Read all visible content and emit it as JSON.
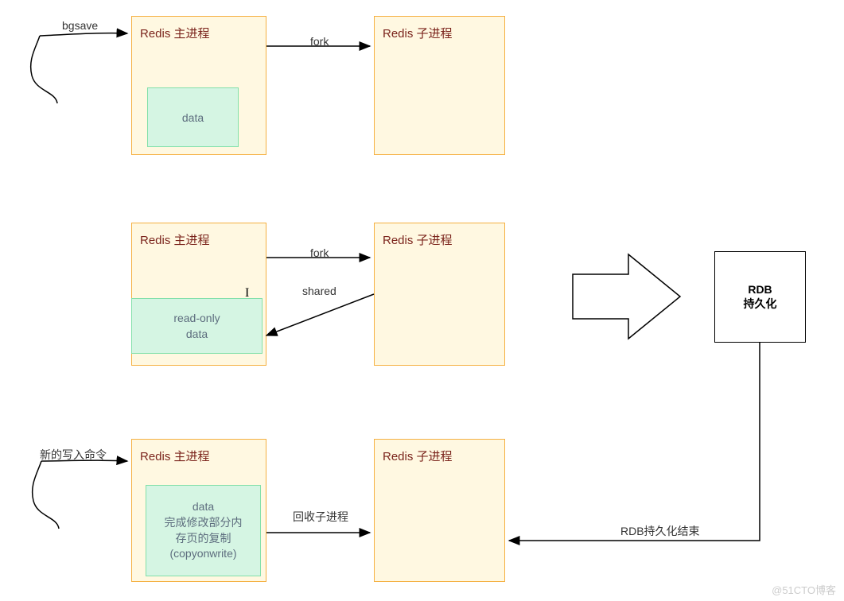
{
  "row1": {
    "mainTitle": "Redis 主进程",
    "childTitle": "Redis 子进程",
    "dataLabel": "data",
    "arrowLabel": "fork",
    "inputLabel": "bgsave"
  },
  "row2": {
    "mainTitle": "Redis 主进程",
    "childTitle": "Redis 子进程",
    "dataLabel1": "read-only",
    "dataLabel2": "data",
    "arrowLabel1": "fork",
    "arrowLabel2": "shared"
  },
  "row3": {
    "mainTitle": "Redis 主进程",
    "childTitle": "Redis 子进程",
    "dataLabel1": "data",
    "dataLabel2": "完成修改部分内",
    "dataLabel3": "存页的复制",
    "dataLabel4": "(copyonwrite)",
    "arrowLabel": "回收子进程",
    "inputLabel": "新的写入命令"
  },
  "rdb": {
    "line1": "RDB",
    "line2": "持久化",
    "endLabel": "RDB持久化结束"
  },
  "watermark": "@51CTO博客"
}
